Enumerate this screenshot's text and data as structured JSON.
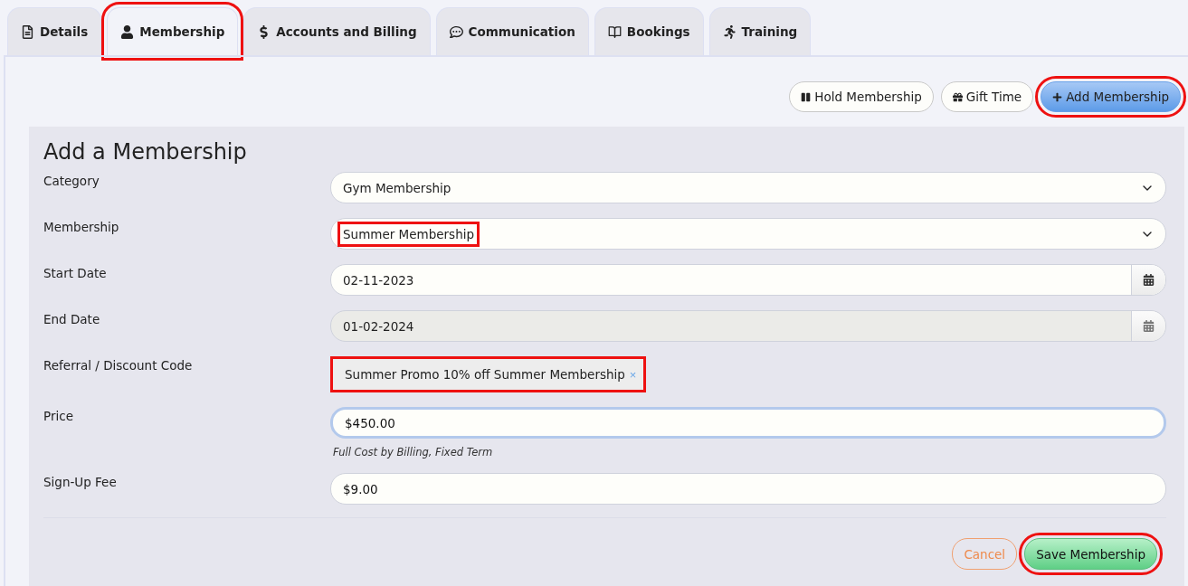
{
  "tabs": [
    {
      "label": "Details",
      "selected": false,
      "highlighted": false
    },
    {
      "label": "Membership",
      "selected": true,
      "highlighted": true
    },
    {
      "label": "Accounts and Billing",
      "selected": false,
      "highlighted": false
    },
    {
      "label": "Communication",
      "selected": false,
      "highlighted": false
    },
    {
      "label": "Bookings",
      "selected": false,
      "highlighted": false
    },
    {
      "label": "Training",
      "selected": false,
      "highlighted": false
    }
  ],
  "actions": [
    {
      "label": "Hold Membership",
      "kind": "default",
      "highlighted": false
    },
    {
      "label": "Gift Time",
      "kind": "default",
      "highlighted": false
    },
    {
      "label": "Add Membership",
      "kind": "primary",
      "highlighted": true
    }
  ],
  "form": {
    "title": "Add a Membership",
    "fields": [
      {
        "label": "Category",
        "kind": "select",
        "value": "Gym Membership",
        "highlighted": false
      },
      {
        "label": "Membership",
        "kind": "select",
        "value": "Summer Membership",
        "highlighted": true
      },
      {
        "label": "Start Date",
        "kind": "date",
        "value": "02-11-2023",
        "disabled": false
      },
      {
        "label": "End Date",
        "kind": "date",
        "value": "01-02-2024",
        "disabled": true
      },
      {
        "label": "Referral / Discount Code",
        "kind": "tag",
        "value": "Summer Promo 10% off Summer Membership",
        "remove": "×",
        "highlighted": true
      },
      {
        "label": "Price",
        "kind": "text",
        "value": "$450.00",
        "focused": true,
        "help": "Full Cost by Billing, Fixed Term"
      },
      {
        "label": "Sign-Up Fee",
        "kind": "text",
        "value": "$9.00",
        "focused": false
      }
    ],
    "buttons": [
      {
        "label": "Cancel",
        "kind": "cancel",
        "highlighted": false
      },
      {
        "label": "Save Membership",
        "kind": "save",
        "highlighted": true
      }
    ]
  }
}
